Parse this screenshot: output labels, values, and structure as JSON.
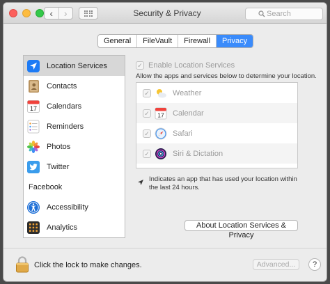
{
  "window": {
    "title": "Security & Privacy",
    "search_placeholder": "Search"
  },
  "tabs": [
    {
      "label": "General",
      "active": false
    },
    {
      "label": "FileVault",
      "active": false
    },
    {
      "label": "Firewall",
      "active": false
    },
    {
      "label": "Privacy",
      "active": true
    }
  ],
  "sidebar": {
    "items": [
      {
        "label": "Location Services",
        "icon": "location-arrow-icon",
        "selected": true
      },
      {
        "label": "Contacts",
        "icon": "contacts-book-icon",
        "selected": false
      },
      {
        "label": "Calendars",
        "icon": "calendar-icon",
        "selected": false
      },
      {
        "label": "Reminders",
        "icon": "reminders-icon",
        "selected": false
      },
      {
        "label": "Photos",
        "icon": "photos-icon",
        "selected": false
      },
      {
        "label": "Twitter",
        "icon": "twitter-icon",
        "selected": false
      },
      {
        "label": "Facebook",
        "icon": "",
        "selected": false
      },
      {
        "label": "Accessibility",
        "icon": "accessibility-icon",
        "selected": false
      },
      {
        "label": "Analytics",
        "icon": "analytics-icon",
        "selected": false
      }
    ]
  },
  "location": {
    "enable_label": "Enable Location Services",
    "enable_checked": true,
    "description": "Allow the apps and services below to determine your location.",
    "apps": [
      {
        "label": "Weather",
        "icon": "weather-icon",
        "checked": true
      },
      {
        "label": "Calendar",
        "icon": "calendar-icon",
        "checked": true
      },
      {
        "label": "Safari",
        "icon": "safari-icon",
        "checked": true
      },
      {
        "label": "Siri & Dictation",
        "icon": "siri-icon",
        "checked": true
      }
    ],
    "calendar_day": "17",
    "note": "Indicates an app that has used your location within the last 24 hours.",
    "about_button": "About Location Services & Privacy"
  },
  "footer": {
    "lock_text": "Click the lock to make changes.",
    "advanced_button": "Advanced...",
    "help_button": "?"
  },
  "colors": {
    "accent": "#3a8bfb",
    "selection": "#d7d7d7"
  }
}
